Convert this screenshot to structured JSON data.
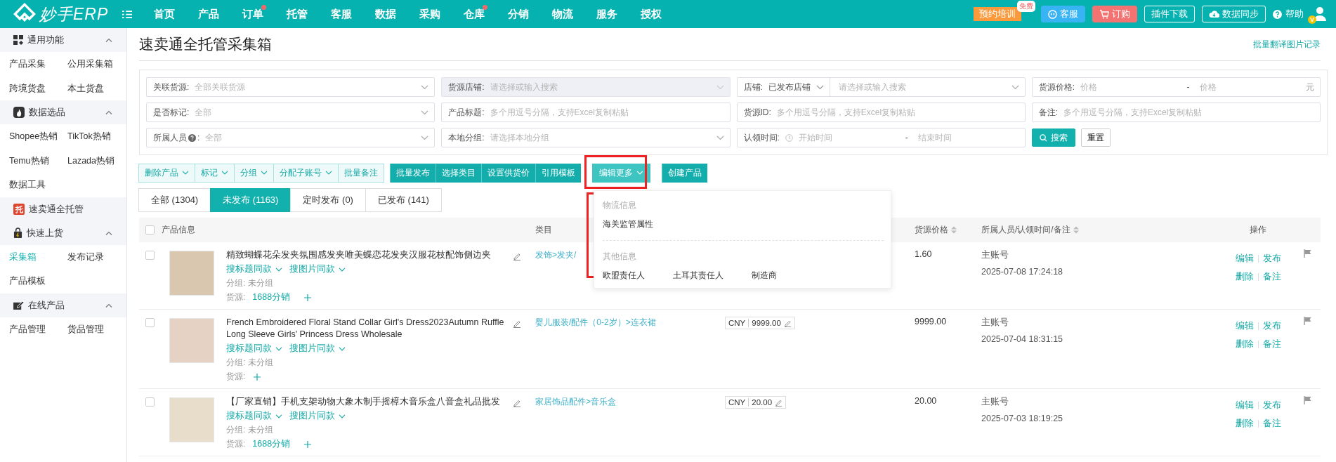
{
  "topbar": {
    "logo": "妙手ERP",
    "nav": [
      {
        "label": "首页",
        "dot": false
      },
      {
        "label": "产品",
        "dot": false
      },
      {
        "label": "订单",
        "dot": true
      },
      {
        "label": "托管",
        "dot": false
      },
      {
        "label": "客服",
        "dot": false
      },
      {
        "label": "数据",
        "dot": false
      },
      {
        "label": "采购",
        "dot": false
      },
      {
        "label": "仓库",
        "dot": true
      },
      {
        "label": "分销",
        "dot": false
      },
      {
        "label": "物流",
        "dot": false
      },
      {
        "label": "服务",
        "dot": false
      },
      {
        "label": "授权",
        "dot": false
      }
    ],
    "training": {
      "label": "预约培训",
      "badge": "免费"
    },
    "buttons": [
      {
        "kind": "service",
        "label": "客服"
      },
      {
        "kind": "order",
        "label": "订购"
      },
      {
        "kind": "plugin",
        "label": "插件下载"
      },
      {
        "kind": "sync",
        "label": "数据同步"
      }
    ],
    "help": "帮助",
    "vip_badge": "V"
  },
  "sidebar": [
    {
      "kind": "group",
      "title": "通用功能",
      "expanded": true,
      "items": [
        {
          "label": "产品采集",
          "selected": false
        },
        {
          "label": "公用采集箱",
          "selected": false
        },
        {
          "label": "跨境货盘",
          "selected": false
        },
        {
          "label": "本土货盘",
          "selected": false
        }
      ]
    },
    {
      "kind": "group",
      "title": "数据选品",
      "expanded": true,
      "items": [
        {
          "label": "Shopee热销",
          "selected": false
        },
        {
          "label": "TikTok热销",
          "selected": false
        },
        {
          "label": "Temu热销",
          "selected": false
        },
        {
          "label": "Lazada热销",
          "selected": false
        },
        {
          "label": "数据工具",
          "selected": false
        }
      ]
    },
    {
      "kind": "link",
      "title": "速卖通全托管",
      "badge": "托"
    },
    {
      "kind": "group",
      "title": "快速上货",
      "expanded": true,
      "items": [
        {
          "label": "采集箱",
          "selected": true
        },
        {
          "label": "发布记录",
          "selected": false
        },
        {
          "label": "产品模板",
          "selected": false
        }
      ]
    },
    {
      "kind": "group",
      "title": "在线产品",
      "expanded": true,
      "items": [
        {
          "label": "产品管理",
          "selected": false
        },
        {
          "label": "货品管理",
          "selected": false
        }
      ]
    }
  ],
  "page": {
    "title": "速卖通全托管采集箱",
    "link": "批量翻译图片记录"
  },
  "filters": [
    {
      "kind": "select",
      "label": "关联货源:",
      "placeholder": "全部关联货源",
      "disabled": false
    },
    {
      "kind": "select",
      "label": "货源店铺:",
      "placeholder": "请选择或输入搜索",
      "disabled": true
    },
    {
      "kind": "shop",
      "label": "店铺:",
      "value": "已发布店铺",
      "placeholder": "请选择或输入搜索"
    },
    {
      "kind": "range",
      "label": "货源价格:",
      "from": "价格",
      "separator": "-",
      "to": "价格",
      "unit": "元"
    },
    {
      "kind": "select",
      "label": "是否标记:",
      "placeholder": "全部",
      "disabled": false
    },
    {
      "kind": "text",
      "label": "产品标题:",
      "placeholder": "多个用逗号分隔，支持Excel复制粘贴"
    },
    {
      "kind": "text",
      "label": "货源ID:",
      "placeholder": "多个用逗号分隔，支持Excel复制粘贴"
    },
    {
      "kind": "text",
      "label": "备注:",
      "placeholder": "多个用逗号分隔，支持Excel复制粘贴"
    },
    {
      "kind": "helpselect",
      "label": "所属人员",
      "colon": ":",
      "placeholder": "全部",
      "disabled": false
    },
    {
      "kind": "select",
      "label": "本地分组:",
      "placeholder": "请选择本地分组",
      "disabled": false
    },
    {
      "kind": "daterange",
      "label": "认领时间:",
      "from": "开始时间",
      "separator": "-",
      "to": "结束时间"
    }
  ],
  "filter_actions": [
    {
      "kind": "primary",
      "label": "搜索"
    },
    {
      "kind": "default",
      "label": "重置"
    }
  ],
  "toolbar": [
    {
      "kind": "outline",
      "items": [
        {
          "label": "删除产品",
          "caret": true
        },
        {
          "label": "标记",
          "caret": true
        },
        {
          "label": "分组",
          "caret": true
        },
        {
          "label": "分配子账号",
          "caret": true
        },
        {
          "label": "批量备注",
          "caret": false
        }
      ]
    },
    {
      "kind": "solid",
      "items": [
        {
          "label": "批量发布",
          "caret": false
        },
        {
          "label": "选择类目",
          "caret": false
        },
        {
          "label": "设置供货价",
          "caret": false
        },
        {
          "label": "引用模板",
          "caret": false
        }
      ]
    },
    {
      "kind": "menu",
      "items": [
        {
          "label": "编辑更多",
          "caret": true
        }
      ]
    },
    {
      "kind": "solid",
      "items": [
        {
          "label": "创建产品",
          "caret": false
        }
      ]
    }
  ],
  "edit_more_menu": [
    {
      "title": "物流信息",
      "items": [
        "海关监管属性"
      ]
    },
    {
      "title": "其他信息",
      "items": [
        "欧盟责任人",
        "土耳其责任人",
        "制造商"
      ]
    }
  ],
  "tabs": [
    {
      "label": "全部 (1304)",
      "selected": false
    },
    {
      "label": "未发布 (1163)",
      "selected": true
    },
    {
      "label": "定时发布 (0)",
      "selected": false
    },
    {
      "label": "已发布 (141)",
      "selected": false
    }
  ],
  "table": {
    "all_checked": false,
    "columns": [
      {
        "label": "产品信息",
        "sortable": false
      },
      {
        "label": "类目",
        "sortable": false
      },
      {
        "label": "货源价格",
        "sortable": true
      },
      {
        "label": "所属人员/认领时间/备注",
        "sortable": true
      },
      {
        "label": "操作",
        "sortable": false
      }
    ],
    "rows": [
      {
        "checked": false,
        "title": "精致蝴蝶花朵发夹氛围感发夹唯美蝶恋花发夹汉服花枝配饰侧边夹",
        "search": [
          "搜标题同款",
          "搜图片同款"
        ],
        "group_label": "分组:",
        "group": "未分组",
        "source_label": "货源:",
        "source": "1688分销",
        "category": "发饰>发夹/",
        "source_price": "1.60",
        "owner": "主账号",
        "time": "2025-07-08 17:24:18",
        "actions": [
          "编辑",
          "发布",
          "删除",
          "备注"
        ]
      },
      {
        "checked": false,
        "title": "French Embroidered Floral Stand Collar Girl's Dress2023Autumn Ruffle Long Sleeve Girls' Princess Dress Wholesale",
        "search": [
          "搜标题同款",
          "搜图片同款"
        ],
        "group_label": "分组:",
        "group": "未分组",
        "source_label": "货源:",
        "category": "婴儿服装/配件（0-2岁）>连衣裙",
        "price": {
          "currency": "CNY",
          "amount": "9999.00"
        },
        "source_price": "9999.00",
        "owner": "主账号",
        "time": "2025-07-04 18:31:15",
        "actions": [
          "编辑",
          "发布",
          "删除",
          "备注"
        ]
      },
      {
        "checked": false,
        "title": "【厂家直销】手机支架动物大象木制手摇樟木音乐盒八音盒礼品批发",
        "search": [
          "搜标题同款",
          "搜图片同款"
        ],
        "group_label": "分组:",
        "group": "未分组",
        "source_label": "货源:",
        "source": "1688分销",
        "category": "家居饰品配件>音乐盒",
        "price": {
          "currency": "CNY",
          "amount": "20.00"
        },
        "source_price": "20.00",
        "owner": "主账号",
        "time": "2025-07-03 18:19:25",
        "actions": [
          "编辑",
          "发布",
          "删除",
          "备注"
        ]
      }
    ]
  }
}
